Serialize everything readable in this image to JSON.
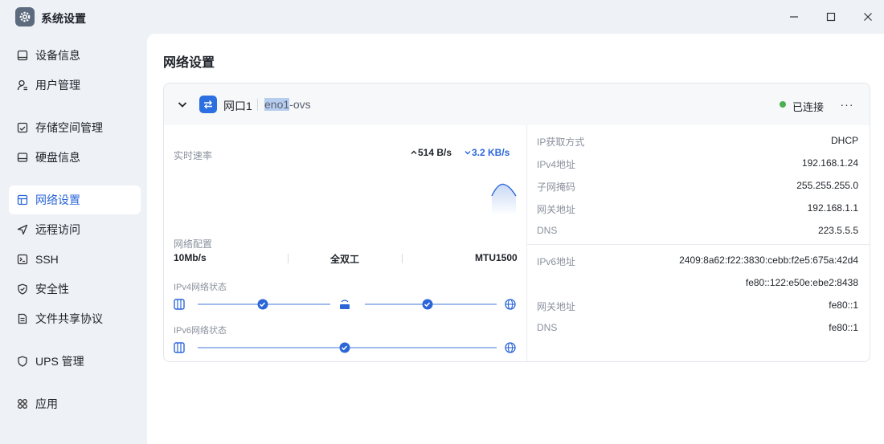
{
  "app": {
    "title": "系统设置"
  },
  "sidebar": {
    "items": [
      {
        "label": "设备信息",
        "icon": "device-icon"
      },
      {
        "label": "用户管理",
        "icon": "user-icon"
      },
      {
        "label": "存储空间管理",
        "icon": "storage-icon"
      },
      {
        "label": "硬盘信息",
        "icon": "disk-icon"
      },
      {
        "label": "网络设置",
        "icon": "network-icon",
        "active": true
      },
      {
        "label": "远程访问",
        "icon": "remote-icon"
      },
      {
        "label": "SSH",
        "icon": "terminal-icon"
      },
      {
        "label": "安全性",
        "icon": "shield-icon"
      },
      {
        "label": "文件共享协议",
        "icon": "file-share-icon"
      },
      {
        "label": "UPS 管理",
        "icon": "ups-icon"
      },
      {
        "label": "应用",
        "icon": "apps-icon"
      }
    ]
  },
  "main": {
    "title": "网络设置",
    "port": {
      "name": "网口1",
      "iface_highlight": "eno1",
      "iface_rest": "-ovs",
      "status": "已连接",
      "status_color": "#4caf50",
      "more": "···"
    },
    "speed": {
      "label": "实时速率",
      "up": "514 B/s",
      "down": "3.2 KB/s"
    },
    "config": {
      "label": "网络配置",
      "speed": "10Mb/s",
      "duplex": "全双工",
      "mtu": "MTU1500"
    },
    "ipv4_status": {
      "label": "IPv4网络状态"
    },
    "ipv6_status": {
      "label": "IPv6网络状态"
    },
    "ipv4": [
      {
        "label": "IP获取方式",
        "value": "DHCP"
      },
      {
        "label": "IPv4地址",
        "value": "192.168.1.24"
      },
      {
        "label": "子网掩码",
        "value": "255.255.255.0"
      },
      {
        "label": "网关地址",
        "value": "192.168.1.1"
      },
      {
        "label": "DNS",
        "value": "223.5.5.5"
      }
    ],
    "ipv6": {
      "addr_label": "IPv6地址",
      "addr1": "2409:8a62:f22:3830:cebb:f2e5:675a:42d4",
      "addr2": "fe80::122:e50e:ebe2:8438",
      "gw_label": "网关地址",
      "gw_value": "fe80::1",
      "dns_label": "DNS",
      "dns_value": "fe80::1"
    },
    "accent": "#2b66d9"
  }
}
